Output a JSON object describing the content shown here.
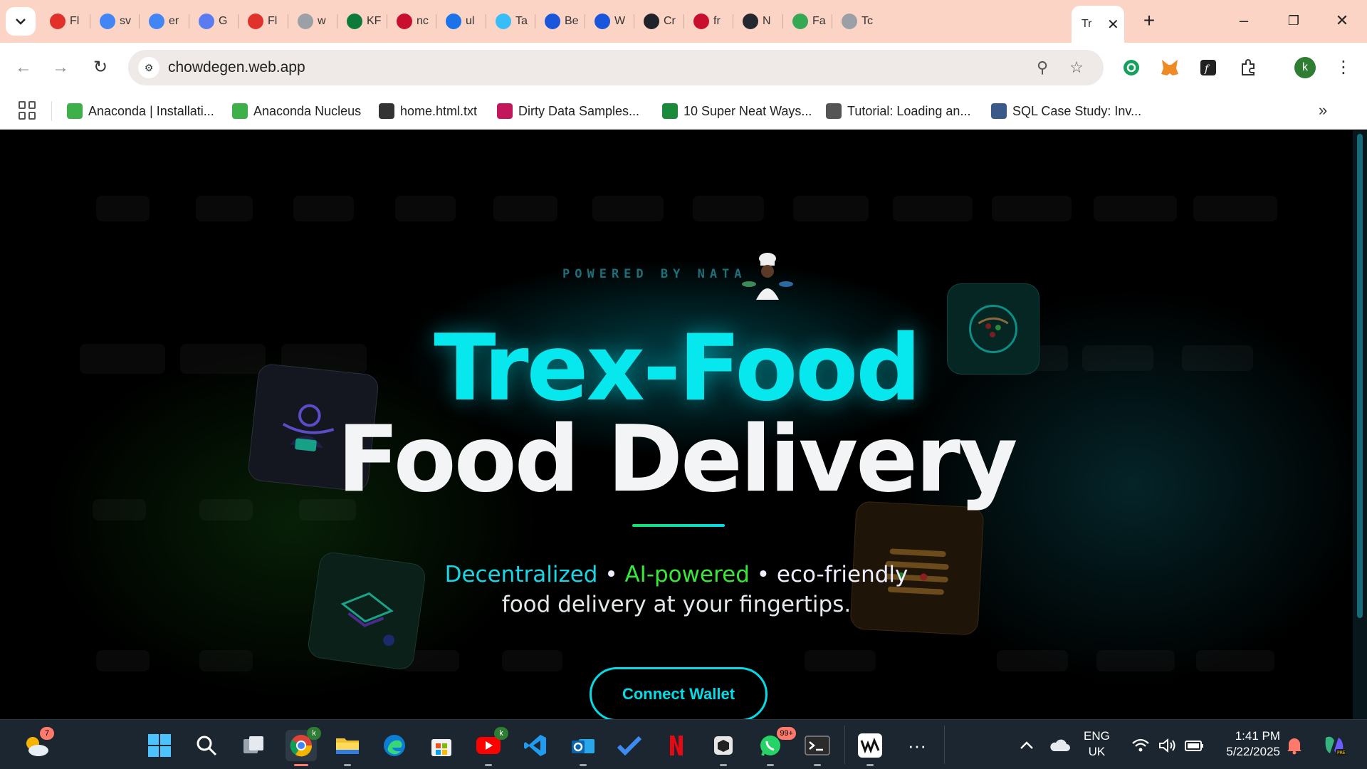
{
  "browser": {
    "tabs": [
      {
        "title": "Fl",
        "icon": "opera-icon",
        "color": "#e0312b"
      },
      {
        "title": "sv",
        "icon": "google-icon",
        "color": "#4285f4"
      },
      {
        "title": "er",
        "icon": "google-icon",
        "color": "#4285f4"
      },
      {
        "title": "G",
        "icon": "gemini-icon",
        "color": "#5a7cf0"
      },
      {
        "title": "Fl",
        "icon": "opera-icon",
        "color": "#e0312b"
      },
      {
        "title": "w",
        "icon": "globe-icon",
        "color": "#9aa0a6"
      },
      {
        "title": "KF",
        "icon": "kf-icon",
        "color": "#0b7a3b"
      },
      {
        "title": "nc",
        "icon": "t-logo-icon",
        "color": "#c8102e"
      },
      {
        "title": "ul",
        "icon": "swirl-icon",
        "color": "#1a73e8"
      },
      {
        "title": "Ta",
        "icon": "tailwind-icon",
        "color": "#38bdf8"
      },
      {
        "title": "Be",
        "icon": "c-logo-icon",
        "color": "#1a56db"
      },
      {
        "title": "W",
        "icon": "c-logo-icon",
        "color": "#1a56db"
      },
      {
        "title": "Cr",
        "icon": "react-icon",
        "color": "#20232a"
      },
      {
        "title": "fr",
        "icon": "frame-icon",
        "color": "#c8102e"
      },
      {
        "title": "N",
        "icon": "github-icon",
        "color": "#24292f"
      },
      {
        "title": "Fa",
        "icon": "play-icon",
        "color": "#34a853"
      },
      {
        "title": "Tc",
        "icon": "globe-icon",
        "color": "#9aa0a6"
      }
    ],
    "active_tab": {
      "title": "Tr"
    },
    "new_tab": "+",
    "window": {
      "minimize": "–",
      "restore": "❐",
      "close": "✕"
    },
    "address": {
      "url": "chowdegen.web.app"
    },
    "bookmarks": [
      {
        "label": "Anaconda | Installati...",
        "icon": "anaconda-icon",
        "color": "#3eb049"
      },
      {
        "label": "Anaconda Nucleus",
        "icon": "anaconda-ring-icon",
        "color": "#3eb049"
      },
      {
        "label": "home.html.txt",
        "icon": "globe-icon",
        "color": "#333333"
      },
      {
        "label": "Dirty Data Samples...",
        "icon": "bar-chart-icon",
        "color": "#c2185b"
      },
      {
        "label": "10 Super Neat Ways...",
        "icon": "check-icon",
        "color": "#1b8a3a"
      },
      {
        "label": "Tutorial: Loading an...",
        "icon": "gear-icon",
        "color": "#555555"
      },
      {
        "label": "SQL Case Study: Inv...",
        "icon": "tds-icon",
        "color": "#3a5a8a"
      }
    ],
    "bookmarks_more": "»",
    "profile_initial": "k"
  },
  "page": {
    "powered_by": "POWERED BY NATA",
    "hero_line1": "Trex-Food",
    "hero_line2": "Food Delivery",
    "tagline": {
      "part1": "Decentralized",
      "sep1": " • ",
      "part2": "AI-powered",
      "sep2": " • ",
      "part3": "eco-friendly",
      "line2": "food delivery at your fingertips."
    },
    "cta_label": "Connect Wallet",
    "accent_cyan": "#05dbe6",
    "accent_green": "#39e63a"
  },
  "taskbar": {
    "weather_badge": "7",
    "whatsapp_badge": "99+",
    "chrome_badge": "k",
    "youtube_badge": "k",
    "lang_line1": "ENG",
    "lang_line2": "UK",
    "time": "1:41 PM",
    "date": "5/22/2025"
  }
}
